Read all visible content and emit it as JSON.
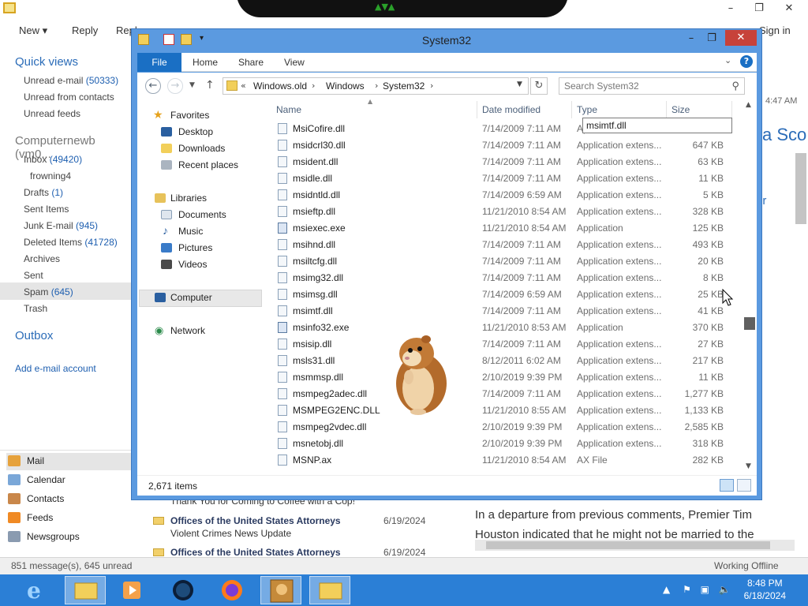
{
  "mail": {
    "toolbar": [
      "New",
      "Reply",
      "Repl"
    ],
    "sign_in": "Sign in",
    "quick_views_title": "Quick views",
    "quick_views": [
      {
        "label": "Unread e-mail",
        "count": "(50333)"
      },
      {
        "label": "Unread from contacts",
        "count": ""
      },
      {
        "label": "Unread feeds",
        "count": ""
      }
    ],
    "account_title": "Computernewb (vm0...",
    "folders": [
      {
        "label": "Inbox",
        "count": "(49420)"
      },
      {
        "label": "frowning4",
        "count": ""
      },
      {
        "label": "Drafts",
        "count": "(1)"
      },
      {
        "label": "Sent Items",
        "count": ""
      },
      {
        "label": "Junk E-mail",
        "count": "(945)"
      },
      {
        "label": "Deleted Items",
        "count": "(41728)"
      },
      {
        "label": "Archives",
        "count": ""
      },
      {
        "label": "Sent",
        "count": ""
      },
      {
        "label": "Spam",
        "count": "(645)"
      },
      {
        "label": "Trash",
        "count": ""
      }
    ],
    "outbox": "Outbox",
    "add_account": "Add e-mail account",
    "nav": [
      "Mail",
      "Calendar",
      "Contacts",
      "Feeds",
      "Newsgroups"
    ],
    "messages": [
      {
        "sender": "",
        "subject": "Thank You for Coming to Coffee with a Cop!",
        "date": ""
      },
      {
        "sender": "Offices of the United States Attorneys",
        "subject": "Violent Crimes News Update",
        "date": "6/19/2024"
      },
      {
        "sender": "Offices of the United States Attorneys",
        "subject": "",
        "date": "6/19/2024"
      }
    ],
    "reading_text": "In a departure from previous comments, Premier Tim Houston indicated that he might not be married to the",
    "reading_partial": [
      "a Sco",
      "er",
      "4:47 AM"
    ],
    "status_left": "851 message(s), 645 unread",
    "status_right": "Working Offline"
  },
  "explorer": {
    "title": "System32",
    "ribbon_tabs": [
      "File",
      "Home",
      "Share",
      "View"
    ],
    "breadcrumb": [
      "Windows.old",
      "Windows",
      "System32"
    ],
    "search_placeholder": "Search System32",
    "nav": {
      "favorites": "Favorites",
      "fav_items": [
        "Desktop",
        "Downloads",
        "Recent places"
      ],
      "libraries": "Libraries",
      "lib_items": [
        "Documents",
        "Music",
        "Pictures",
        "Videos"
      ],
      "computer": "Computer",
      "network": "Network"
    },
    "columns": {
      "name": "Name",
      "date": "Date modified",
      "type": "Type",
      "size": "Size"
    },
    "rename_value": "msimtf.dll",
    "files": [
      {
        "name": "MsiCofire.dll",
        "date": "7/14/2009 7:11 AM",
        "type": "Ap",
        "size": ""
      },
      {
        "name": "msidcrl30.dll",
        "date": "7/14/2009 7:11 AM",
        "type": "Application extens...",
        "size": "647 KB"
      },
      {
        "name": "msident.dll",
        "date": "7/14/2009 7:11 AM",
        "type": "Application extens...",
        "size": "63 KB"
      },
      {
        "name": "msidle.dll",
        "date": "7/14/2009 7:11 AM",
        "type": "Application extens...",
        "size": "11 KB"
      },
      {
        "name": "msidntld.dll",
        "date": "7/14/2009 6:59 AM",
        "type": "Application extens...",
        "size": "5 KB"
      },
      {
        "name": "msieftp.dll",
        "date": "11/21/2010 8:54 AM",
        "type": "Application extens...",
        "size": "328 KB"
      },
      {
        "name": "msiexec.exe",
        "date": "11/21/2010 8:54 AM",
        "type": "Application",
        "size": "125 KB"
      },
      {
        "name": "msihnd.dll",
        "date": "7/14/2009 7:11 AM",
        "type": "Application extens...",
        "size": "493 KB"
      },
      {
        "name": "msiltcfg.dll",
        "date": "7/14/2009 7:11 AM",
        "type": "Application extens...",
        "size": "20 KB"
      },
      {
        "name": "msimg32.dll",
        "date": "7/14/2009 7:11 AM",
        "type": "Application extens...",
        "size": "8 KB"
      },
      {
        "name": "msimsg.dll",
        "date": "7/14/2009 6:59 AM",
        "type": "Application extens...",
        "size": "25 KB"
      },
      {
        "name": "msimtf.dll",
        "date": "7/14/2009 7:11 AM",
        "type": "Application extens...",
        "size": "41 KB"
      },
      {
        "name": "msinfo32.exe",
        "date": "11/21/2010 8:53 AM",
        "type": "Application",
        "size": "370 KB"
      },
      {
        "name": "msisip.dll",
        "date": "7/14/2009 7:11 AM",
        "type": "Application extens...",
        "size": "27 KB"
      },
      {
        "name": "msls31.dll",
        "date": "8/12/2011 6:02 AM",
        "type": "Application extens...",
        "size": "217 KB"
      },
      {
        "name": "msmmsp.dll",
        "date": "2/10/2019 9:39 PM",
        "type": "Application extens...",
        "size": "11 KB"
      },
      {
        "name": "msmpeg2adec.dll",
        "date": "7/14/2009 7:11 AM",
        "type": "Application extens...",
        "size": "1,277 KB"
      },
      {
        "name": "MSMPEG2ENC.DLL",
        "date": "11/21/2010 8:55 AM",
        "type": "Application extens...",
        "size": "1,133 KB"
      },
      {
        "name": "msmpeg2vdec.dll",
        "date": "2/10/2019 9:39 PM",
        "type": "Application extens...",
        "size": "2,585 KB"
      },
      {
        "name": "msnetobj.dll",
        "date": "2/10/2019 9:39 PM",
        "type": "Application extens...",
        "size": "318 KB"
      },
      {
        "name": "MSNP.ax",
        "date": "11/21/2010 8:54 AM",
        "type": "AX File",
        "size": "282 KB"
      }
    ],
    "item_count": "2,671 items"
  },
  "taskbar": {
    "time": "8:48 PM",
    "date": "6/18/2024"
  },
  "colors": {
    "window_border": "#5b9ae0",
    "taskbar": "#2b7fd6",
    "accent": "#1a6fc4",
    "close": "#c7423a"
  }
}
